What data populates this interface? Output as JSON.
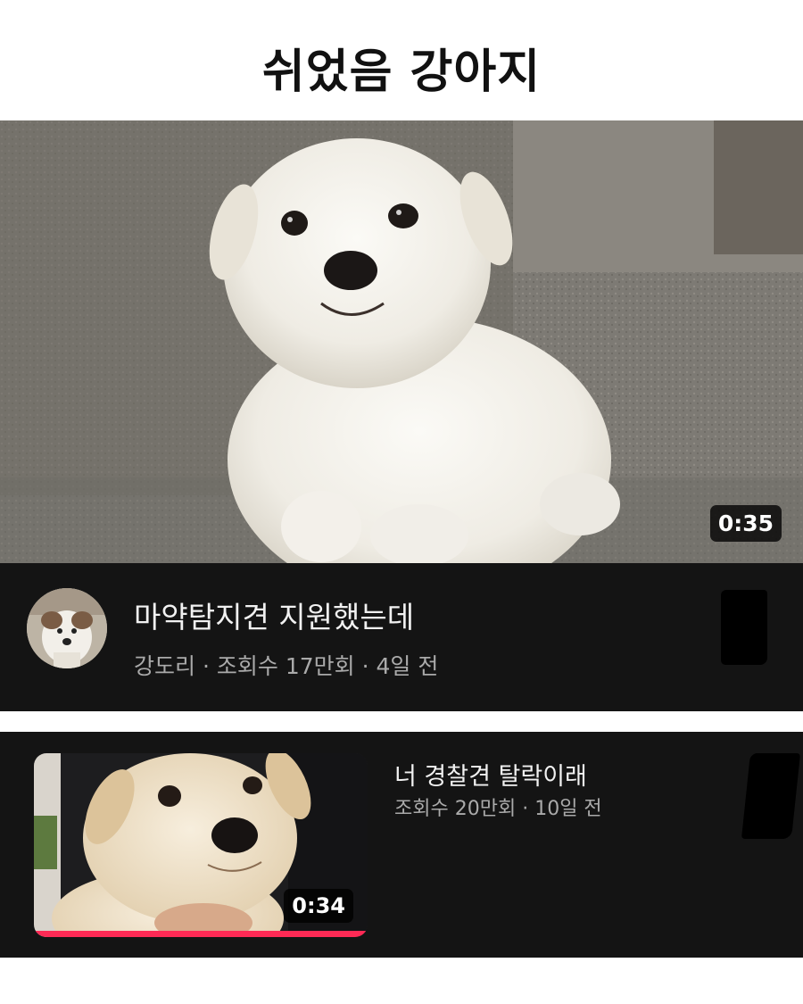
{
  "page": {
    "title": "쉬었음 강아지"
  },
  "video1": {
    "title": "마약탐지견 지원했는데",
    "channel": "강도리",
    "separator": "·",
    "views": "조회수 17만회",
    "age": "4일 전",
    "duration": "0:35",
    "thumbnail_icon": "white-puppy-thumbnail",
    "avatar_icon": "puppy-avatar"
  },
  "video2": {
    "title": "너 경찰견 탈락이래",
    "views": "조회수 20만회",
    "separator": "·",
    "age": "10일 전",
    "duration": "0:34",
    "watched_fraction": 1.0,
    "thumbnail_icon": "cream-puppy-thumbnail"
  },
  "colors": {
    "card_background": "#141414",
    "progress_bar": "#ff2a55",
    "title_text": "#f1f1f1",
    "meta_text": "#aaaaaa"
  }
}
